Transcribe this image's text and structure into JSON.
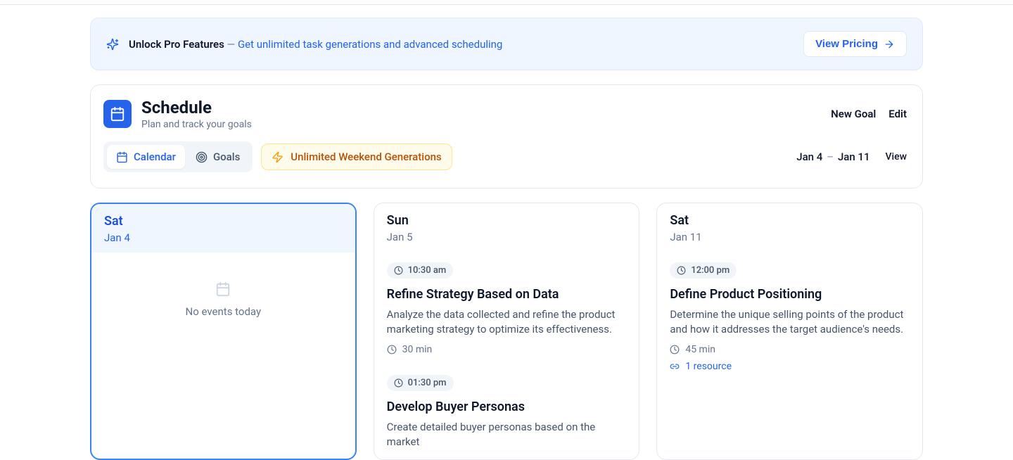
{
  "banner": {
    "title": "Unlock Pro Features",
    "separator": " — ",
    "description": "Get unlimited task generations and advanced scheduling",
    "cta": "View Pricing"
  },
  "schedule": {
    "title": "Schedule",
    "subtitle": "Plan and track your goals",
    "actions": {
      "new_goal": "New Goal",
      "edit": "Edit"
    },
    "tabs": {
      "calendar": "Calendar",
      "goals": "Goals"
    },
    "promo": "Unlimited Weekend Generations",
    "date_range": {
      "start": "Jan 4",
      "end": "Jan 11"
    },
    "view_label": "View"
  },
  "days": [
    {
      "name": "Sat",
      "date": "Jan 4",
      "active": true,
      "no_events_label": "No events today",
      "events": []
    },
    {
      "name": "Sun",
      "date": "Jan 5",
      "active": false,
      "events": [
        {
          "time": "10:30 am",
          "title": "Refine Strategy Based on Data",
          "description": "Analyze the data collected and refine the product marketing strategy to optimize its effectiveness.",
          "duration": "30 min"
        },
        {
          "time": "01:30 pm",
          "title": "Develop Buyer Personas",
          "description": "Create detailed buyer personas based on the market"
        }
      ]
    },
    {
      "name": "Sat",
      "date": "Jan 11",
      "active": false,
      "events": [
        {
          "time": "12:00 pm",
          "title": "Define Product Positioning",
          "description": "Determine the unique selling points of the product and how it addresses the target audience's needs.",
          "duration": "45 min",
          "resources": "1 resource"
        }
      ]
    }
  ]
}
